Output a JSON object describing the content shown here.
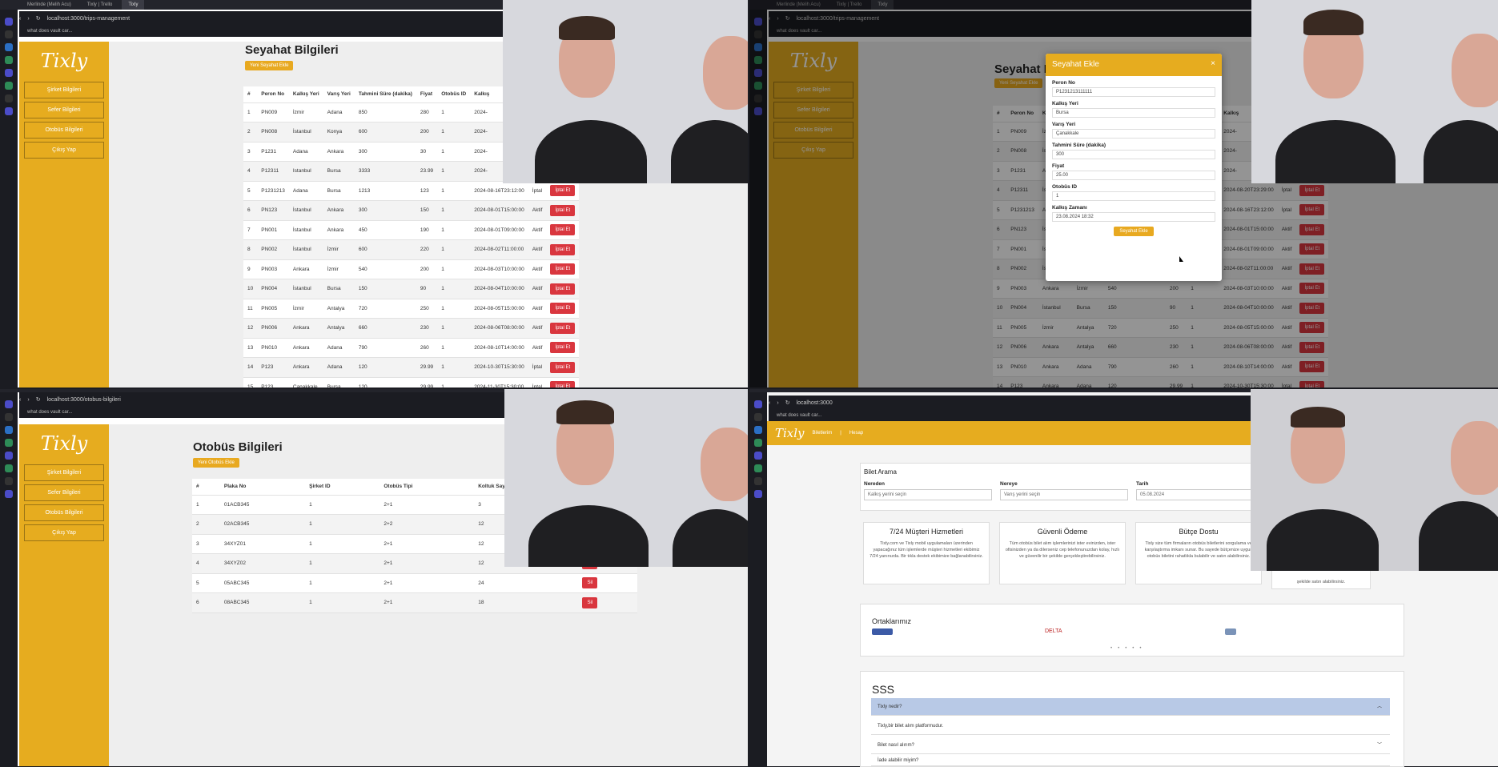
{
  "q1": {
    "tabs": [
      "Merlinde (Melih Acu)",
      "Tixly | Trello",
      "Tixly"
    ],
    "url": "localhost:3000/trips-management",
    "bookmark": "what does vault car...",
    "logo": "Tixly",
    "menu": [
      "Şirket Bilgileri",
      "Sefer Bilgileri",
      "Otobüs Bilgileri",
      "Çıkış Yap"
    ],
    "title": "Seyahat Bilgileri",
    "add_button": "Yeni Seyahat Ekle",
    "columns": [
      "#",
      "Peron No",
      "Kalkış Yeri",
      "Varış Yeri",
      "Tahmini Süre (dakika)",
      "Fiyat",
      "Otobüs ID",
      "Kalkış"
    ],
    "rows": [
      [
        "1",
        "PN009",
        "İzmir",
        "Adana",
        "850",
        "280",
        "1",
        "2024-",
        "",
        ""
      ],
      [
        "2",
        "PN008",
        "İstanbul",
        "Konya",
        "600",
        "200",
        "1",
        "2024-",
        "",
        ""
      ],
      [
        "3",
        "P1231",
        "Adana",
        "Ankara",
        "300",
        "30",
        "1",
        "2024-",
        "",
        ""
      ],
      [
        "4",
        "P12311",
        "Istanbul",
        "Bursa",
        "3333",
        "23.99",
        "1",
        "2024-",
        "",
        ""
      ],
      [
        "5",
        "P1231213",
        "Adana",
        "Bursa",
        "1213",
        "123",
        "1",
        "2024-08-16T23:12:00",
        "İptal",
        "İptal Et"
      ],
      [
        "6",
        "PN123",
        "İstanbul",
        "Ankara",
        "300",
        "150",
        "1",
        "2024-08-01T15:00:00",
        "Aktif",
        "İptal Et"
      ],
      [
        "7",
        "PN001",
        "İstanbul",
        "Ankara",
        "450",
        "190",
        "1",
        "2024-08-01T09:00:00",
        "Aktif",
        "İptal Et"
      ],
      [
        "8",
        "PN002",
        "İstanbul",
        "İzmir",
        "600",
        "220",
        "1",
        "2024-08-02T11:00:00",
        "Aktif",
        "İptal Et"
      ],
      [
        "9",
        "PN003",
        "Ankara",
        "İzmir",
        "540",
        "200",
        "1",
        "2024-08-03T10:00:00",
        "Aktif",
        "İptal Et"
      ],
      [
        "10",
        "PN004",
        "İstanbul",
        "Bursa",
        "150",
        "90",
        "1",
        "2024-08-04T10:00:00",
        "Aktif",
        "İptal Et"
      ],
      [
        "11",
        "PN005",
        "İzmir",
        "Antalya",
        "720",
        "250",
        "1",
        "2024-08-05T15:00:00",
        "Aktif",
        "İptal Et"
      ],
      [
        "12",
        "PN006",
        "Ankara",
        "Antalya",
        "660",
        "230",
        "1",
        "2024-08-06T08:00:00",
        "Aktif",
        "İptal Et"
      ],
      [
        "13",
        "PN010",
        "Ankara",
        "Adana",
        "790",
        "260",
        "1",
        "2024-08-10T14:00:00",
        "Aktif",
        "İptal Et"
      ],
      [
        "14",
        "P123",
        "Ankara",
        "Adana",
        "120",
        "29.99",
        "1",
        "2024-10-30T15:30:00",
        "İptal",
        "İptal Et"
      ],
      [
        "15",
        "P123",
        "Çanakkale",
        "Bursa",
        "120",
        "29.99",
        "1",
        "2024-11-30T15:30:00",
        "İptal",
        "İptal Et"
      ]
    ]
  },
  "q2": {
    "tabs": [
      "Merlinde (Melih Acu)",
      "Tixly | Trello",
      "Tixly"
    ],
    "url": "localhost:3000/trips-management",
    "bookmark": "what does vault car...",
    "logo": "Tixly",
    "menu": [
      "Şirket Bilgileri",
      "Sefer Bilgileri",
      "Otobüs Bilgileri",
      "Çıkış Yap"
    ],
    "title": "Seyahat B",
    "add_button": "Yeni Seyahat Ekle",
    "columns": [
      "#",
      "Peron No",
      "Kalkış Yeri",
      "Varış Yeri",
      "Tahmini Süre (dakika)",
      "Fiyat",
      "Otobüs ID",
      "Kalkış"
    ],
    "rows": [
      [
        "1",
        "PN009",
        "İzmir",
        "Adana",
        "850",
        "280",
        "1",
        "2024-",
        "",
        ""
      ],
      [
        "2",
        "PN008",
        "İstanbul",
        "Konya",
        "600",
        "200",
        "1",
        "2024-",
        "",
        ""
      ],
      [
        "3",
        "P1231",
        "Adana",
        "Ankara",
        "300",
        "30",
        "1",
        "2024-",
        "",
        ""
      ],
      [
        "4",
        "P12311",
        "İstanbul",
        "Bursa",
        "3333",
        "23.99",
        "1",
        "2024-08-20T23:29:00",
        "İptal",
        "İptal Et"
      ],
      [
        "5",
        "P1231213",
        "Adana",
        "Bursa",
        "1213",
        "123",
        "1",
        "2024-08-16T23:12:00",
        "İptal",
        "İptal Et"
      ],
      [
        "6",
        "PN123",
        "İstanbul",
        "Ankara",
        "300",
        "150",
        "1",
        "2024-08-01T15:00:00",
        "Aktif",
        "İptal Et"
      ],
      [
        "7",
        "PN001",
        "İstanbul",
        "Ankara",
        "450",
        "190",
        "1",
        "2024-08-01T09:00:00",
        "Aktif",
        "İptal Et"
      ],
      [
        "8",
        "PN002",
        "İstanbul",
        "İzmir",
        "600",
        "220",
        "1",
        "2024-08-02T11:00:00",
        "Aktif",
        "İptal Et"
      ],
      [
        "9",
        "PN003",
        "Ankara",
        "İzmir",
        "540",
        "200",
        "1",
        "2024-08-03T10:00:00",
        "Aktif",
        "İptal Et"
      ],
      [
        "10",
        "PN004",
        "İstanbul",
        "Bursa",
        "150",
        "90",
        "1",
        "2024-08-04T10:00:00",
        "Aktif",
        "İptal Et"
      ],
      [
        "11",
        "PN005",
        "İzmir",
        "Antalya",
        "720",
        "250",
        "1",
        "2024-08-05T15:00:00",
        "Aktif",
        "İptal Et"
      ],
      [
        "12",
        "PN006",
        "Ankara",
        "Antalya",
        "660",
        "230",
        "1",
        "2024-08-06T08:00:00",
        "Aktif",
        "İptal Et"
      ],
      [
        "13",
        "PN010",
        "Ankara",
        "Adana",
        "790",
        "260",
        "1",
        "2024-08-10T14:00:00",
        "Aktif",
        "İptal Et"
      ],
      [
        "14",
        "P123",
        "Ankara",
        "Adana",
        "120",
        "29.99",
        "1",
        "2024-10-30T15:30:00",
        "İptal",
        "İptal Et"
      ]
    ],
    "modal": {
      "title": "Seyahat Ekle",
      "close": "×",
      "fields": [
        {
          "label": "Peron No",
          "value": "P1231213111111"
        },
        {
          "label": "Kalkış Yeri",
          "value": "Bursa"
        },
        {
          "label": "Varış Yeri",
          "value": "Çanakkale"
        },
        {
          "label": "Tahmini Süre (dakika)",
          "value": "300"
        },
        {
          "label": "Fiyat",
          "value": "25.00"
        },
        {
          "label": "Otobüs ID",
          "value": "1"
        },
        {
          "label": "Kalkış Zamanı",
          "value": "23.08.2024 18:32"
        }
      ],
      "submit": "Seyahat Ekle"
    }
  },
  "q3": {
    "tabs": [],
    "url": "localhost:3000/otobus-bilgileri",
    "bookmark": "what does vault car...",
    "logo": "Tixly",
    "menu": [
      "Şirket Bilgileri",
      "Sefer Bilgileri",
      "Otobüs Bilgileri",
      "Çıkış Yap"
    ],
    "title": "Otobüs Bilgileri",
    "add_button": "Yeni Otobüs Ekle",
    "columns": [
      "#",
      "Plaka No",
      "Şirket ID",
      "Otobüs Tipi",
      "Koltuk Sayısı",
      ""
    ],
    "rows": [
      [
        "1",
        "01ACB345",
        "1",
        "2+1",
        "3",
        ""
      ],
      [
        "2",
        "02ACB345",
        "1",
        "2+2",
        "12",
        ""
      ],
      [
        "3",
        "34XYZ01",
        "1",
        "2+1",
        "12",
        ""
      ],
      [
        "4",
        "34XYZ02",
        "1",
        "2+1",
        "12",
        "Sil"
      ],
      [
        "5",
        "05ABC345",
        "1",
        "2+1",
        "24",
        "Sil"
      ],
      [
        "6",
        "08ABC345",
        "1",
        "2+1",
        "18",
        "Sil"
      ]
    ]
  },
  "q4": {
    "url": "localhost:3000",
    "bookmark": "what does vault car...",
    "header": {
      "logo": "Tixly",
      "nav": [
        "Biletlerim",
        "|",
        "Hesap"
      ]
    },
    "search": {
      "title": "Bilet Arama",
      "from_label": "Nereden",
      "from_placeholder": "Kalkış yerini seçin",
      "to_label": "Nereye",
      "to_placeholder": "Varış yerini seçin",
      "date_label": "Tarih",
      "date_value": "05.08.2024"
    },
    "cards": [
      {
        "title": "7/24 Müşteri Hizmetleri",
        "text": "Tixly.com ve Tixly mobil uygulamaları üzerinden yapacağınız tüm işlemlerde müşteri hizmetleri ekibimiz 7/24 yanınızda. Bir tıkla destek ekibimize bağlanabilirsiniz."
      },
      {
        "title": "Güvenli Ödeme",
        "text": "Tüm otobüs bilet alım işlemlerinizi ister evinizden, ister ofisinizden ya da dilerseniz cep telefonunuzdan kolay, hızlı ve güvenilir bir şekilde gerçekleştirebilirsiniz."
      },
      {
        "title": "Bütçe Dostu",
        "text": "Tixly size tüm firmaların otobüs biletlerini sorgulama ve karşılaştırma imkanı sunar. Bu sayede bütçenize uygun otobüs biletini rahatlıkla bulabilir ve satın alabilirsiniz."
      },
      {
        "title": "",
        "text": "şekilde satın alabilirsiniz."
      }
    ],
    "partners_title": "Ortaklarımız",
    "partners": [
      "DELTA"
    ],
    "faq_title": "SSS",
    "faq": [
      {
        "q": "Tixly nedir?",
        "a": "Tixly,bir bilet alım platformudur."
      },
      {
        "q": "Bilet nasıl alırım?"
      },
      {
        "q": "İade alabilir miyim?"
      }
    ]
  },
  "colors": {
    "brand": "#e6ac1f",
    "danger": "#d9363e",
    "faq_open": "#b8c9e6"
  }
}
